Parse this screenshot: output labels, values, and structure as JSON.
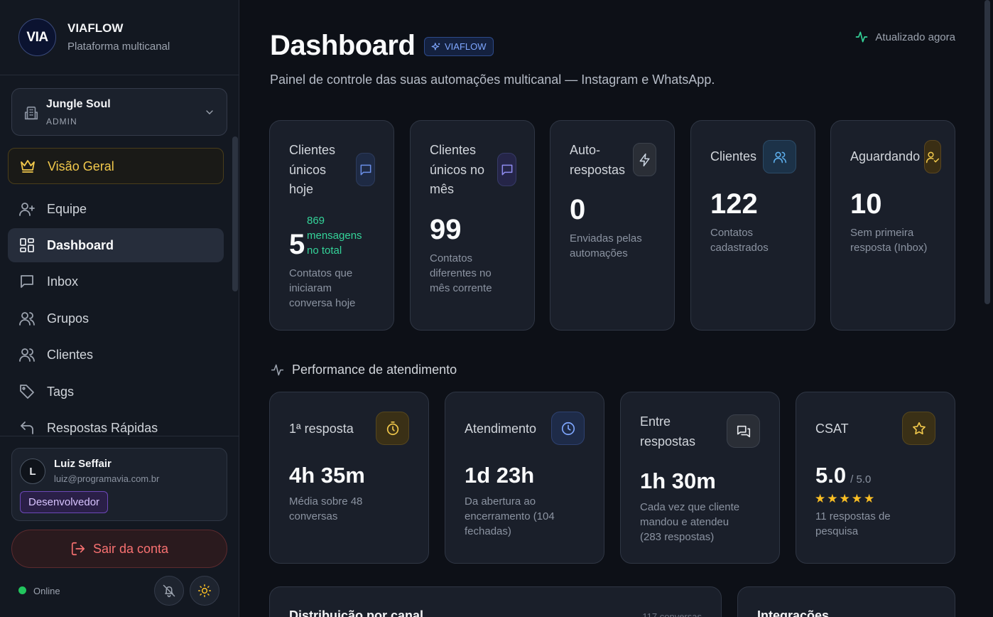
{
  "brand": {
    "logo_text": "VIA",
    "name": "VIAFLOW",
    "subtitle": "Plataforma multicanal"
  },
  "workspace": {
    "name": "Jungle Soul",
    "role": "ADMIN"
  },
  "nav": {
    "overview": "Visão Geral",
    "items": [
      {
        "label": "Equipe"
      },
      {
        "label": "Dashboard"
      },
      {
        "label": "Inbox"
      },
      {
        "label": "Grupos"
      },
      {
        "label": "Clientes"
      },
      {
        "label": "Tags"
      },
      {
        "label": "Respostas Rápidas"
      }
    ]
  },
  "user": {
    "initial": "L",
    "name": "Luiz Seffair",
    "email": "luiz@programavia.com.br",
    "badge": "Desenvolvedor"
  },
  "logout_label": "Sair da conta",
  "status": {
    "label": "Online",
    "color": "#22c55e"
  },
  "header": {
    "title": "Dashboard",
    "badge": "VIAFLOW",
    "updated": "Atualizado agora",
    "subtitle": "Painel de controle das suas automações multicanal — Instagram e WhatsApp."
  },
  "stats": [
    {
      "label_lines": [
        "Clientes",
        "únicos",
        "hoje"
      ],
      "value": "5",
      "extra_lines": [
        "869",
        "mensagens",
        "no total"
      ],
      "desc_lines": [
        "Contatos que",
        "iniciaram",
        "conversa hoje"
      ],
      "icon": "message-icon"
    },
    {
      "label_lines": [
        "Clientes",
        "únicos no",
        "mês"
      ],
      "value": "99",
      "desc_lines": [
        "Contatos",
        "diferentes no",
        "mês corrente"
      ],
      "icon": "message-icon"
    },
    {
      "label_lines": [
        "Auto-",
        "respostas"
      ],
      "value": "0",
      "desc_lines": [
        "Enviadas pelas",
        "automações"
      ],
      "icon": "zap-icon"
    },
    {
      "label_lines": [
        "Clientes"
      ],
      "value": "122",
      "desc_lines": [
        "Contatos",
        "cadastrados"
      ],
      "icon": "users-icon"
    },
    {
      "label_lines": [
        "Aguardando"
      ],
      "value": "10",
      "desc_lines": [
        "Sem primeira",
        "resposta (Inbox)"
      ],
      "icon": "user-check-icon"
    }
  ],
  "performance": {
    "title": "Performance de atendimento",
    "cards": [
      {
        "label_lines": [
          "1ª resposta"
        ],
        "value": "4h 35m",
        "desc_lines": [
          "Média sobre 48",
          "conversas"
        ],
        "icon": "timer-icon"
      },
      {
        "label_lines": [
          "Atendimento"
        ],
        "value": "1d 23h",
        "desc_lines": [
          "Da abertura ao",
          "encerramento (104",
          "fechadas)"
        ],
        "icon": "clock-icon"
      },
      {
        "label_lines": [
          "Entre",
          "respostas"
        ],
        "value": "1h 30m",
        "desc_lines": [
          "Cada vez que cliente",
          "mandou e atendeu",
          "(283 respostas)"
        ],
        "icon": "chat-icon"
      },
      {
        "label_lines": [
          "CSAT"
        ],
        "value": "5.0",
        "value_suffix": "/ 5.0",
        "rating": 5,
        "desc_lines": [
          "11 respostas de",
          "pesquisa"
        ],
        "icon": "star-icon"
      }
    ]
  },
  "bottom": {
    "distribution_title": "Distribuição por canal",
    "distribution_meta": "117 conversas",
    "integrations_title": "Integrações"
  }
}
